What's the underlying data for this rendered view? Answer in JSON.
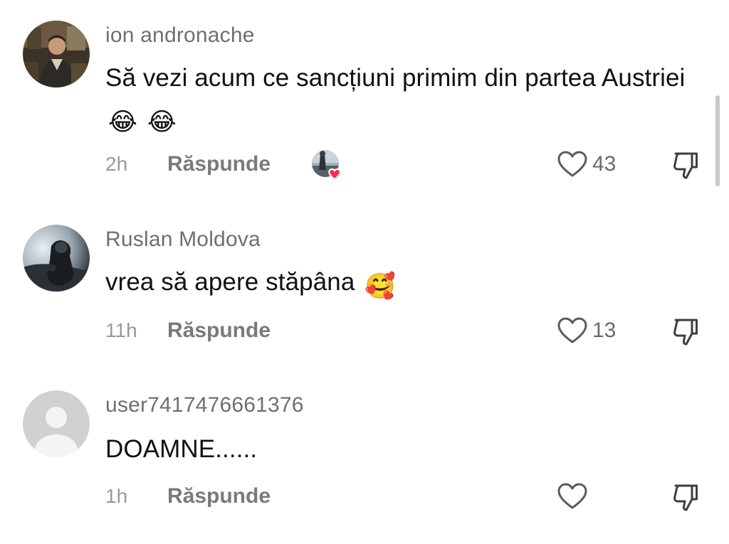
{
  "comments": [
    {
      "username": "ion andronache",
      "text": "Să vezi acum ce sancțiuni primim din partea Austriei",
      "emojis": [
        "😂",
        "😂"
      ],
      "time": "2h",
      "reply_label": "Răspunde",
      "likes": "43",
      "liked_by_creator": true,
      "avatar": "photo-avatar-man-indoor"
    },
    {
      "username": "Ruslan Moldova",
      "text": "vrea să apere stăpâna",
      "emojis": [
        "🥰"
      ],
      "time": "11h",
      "reply_label": "Răspunde",
      "likes": "13",
      "avatar": "photo-avatar-astronaut"
    },
    {
      "username": "user7417476661376",
      "text": "DOAMNE......",
      "time": "1h",
      "reply_label": "Răspunde",
      "likes": "",
      "avatar": "default-avatar"
    }
  ],
  "icons": {
    "like": "heart-outline-icon",
    "dislike": "thumbs-down-icon",
    "creator_like": "creator-liked-heart-icon"
  },
  "colors": {
    "username": "#6f6f6f",
    "text": "#111111",
    "meta": "#9a9a9a",
    "heart_badge": "#fe2c55"
  }
}
